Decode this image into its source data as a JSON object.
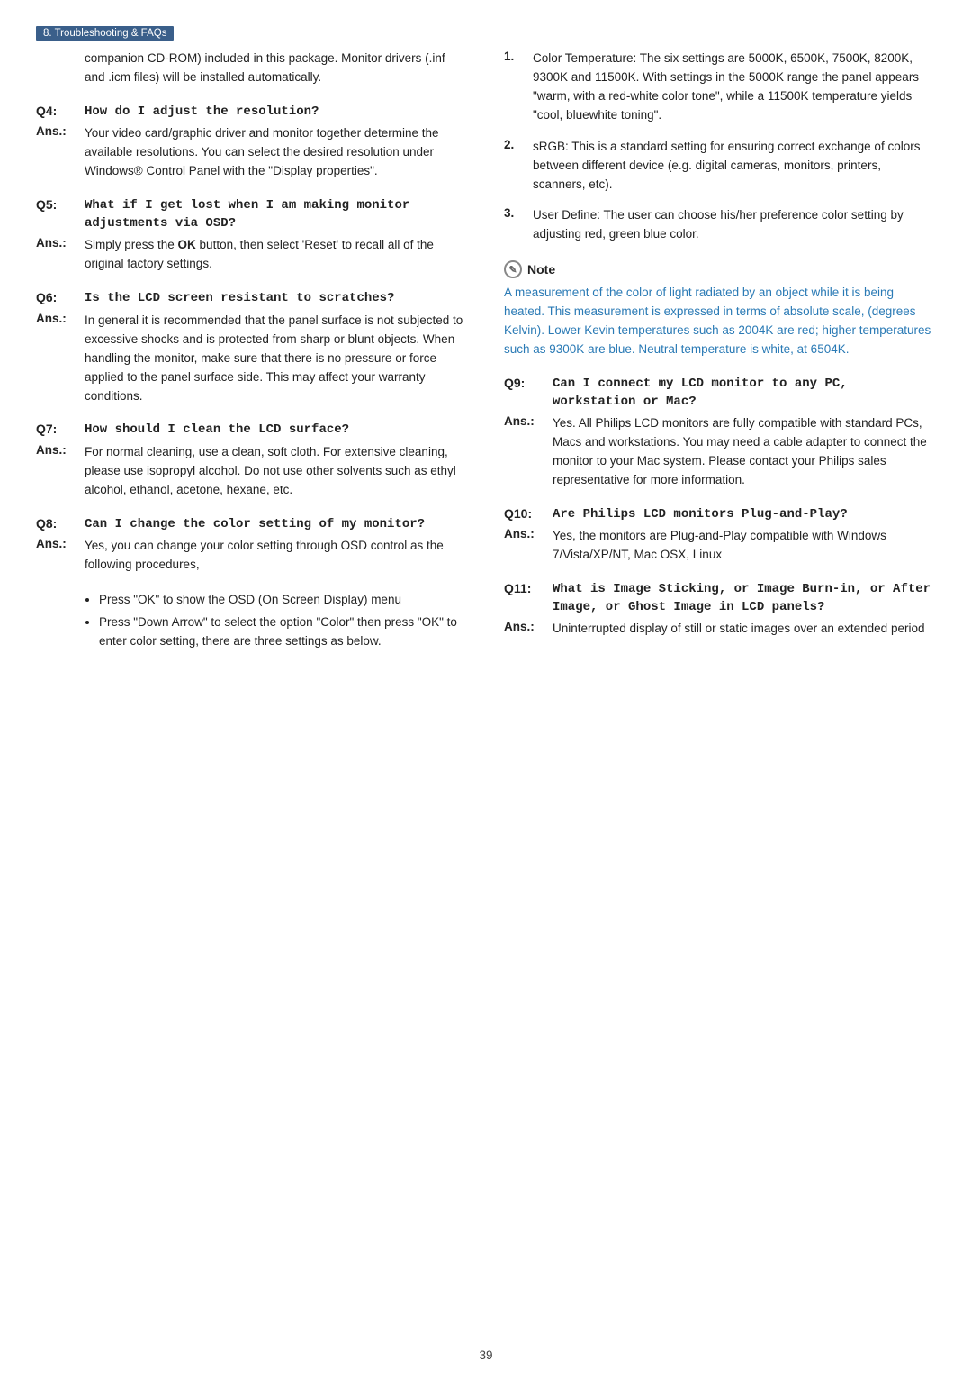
{
  "header": {
    "tag": "8. Troubleshooting & FAQs"
  },
  "intro": {
    "text": "companion CD-ROM) included in this package. Monitor drivers (.inf and .icm files) will be installed automatically."
  },
  "left_column": {
    "qa": [
      {
        "id": "q4",
        "q_label": "Q4:",
        "q_text": "How do I adjust the resolution?",
        "a_label": "Ans.:",
        "a_text": "Your video card/graphic driver and monitor together determine the available resolutions. You can select the desired resolution under Windows® Control Panel with the \"Display properties\"."
      },
      {
        "id": "q5",
        "q_label": "Q5:",
        "q_text": "What if I get lost when I am making monitor adjustments via OSD?",
        "a_label": "Ans.:",
        "a_text_pre": "Simply press the ",
        "a_bold": "OK",
        "a_text_post": " button, then select 'Reset' to recall all of the original factory settings."
      },
      {
        "id": "q6",
        "q_label": "Q6:",
        "q_text": "Is the LCD screen resistant to scratches?",
        "a_label": "Ans.:",
        "a_text": "In general it is recommended that the panel surface is not subjected to excessive shocks and is protected from sharp or blunt objects. When handling the monitor, make sure that there is no pressure or force applied to the panel surface side. This may affect your warranty conditions."
      },
      {
        "id": "q7",
        "q_label": "Q7:",
        "q_text": "How should I clean the LCD surface?",
        "a_label": "Ans.:",
        "a_text": "For normal cleaning, use a clean, soft cloth. For extensive cleaning, please use isopropyl alcohol. Do not use other solvents such as ethyl alcohol, ethanol, acetone, hexane, etc."
      },
      {
        "id": "q8",
        "q_label": "Q8:",
        "q_text": "Can I change the color setting of my monitor?",
        "a_label": "Ans.:",
        "a_text": "Yes, you can change your color setting through OSD control as the following procedures,"
      },
      {
        "id": "q8_bullets",
        "bullets": [
          "Press \"OK\" to show the OSD (On Screen Display) menu",
          "Press \"Down Arrow\" to select the option \"Color\" then press \"OK\" to enter color setting, there are three settings as below."
        ]
      }
    ]
  },
  "right_column": {
    "numbered_items": [
      {
        "num": "1.",
        "text": "Color Temperature: The six settings are 5000K, 6500K, 7500K, 8200K, 9300K and 11500K. With settings in the 5000K range the panel appears \"warm, with a red-white color tone\", while a 11500K temperature yields \"cool, bluewhite toning\"."
      },
      {
        "num": "2.",
        "text": "sRGB: This is a standard setting for ensuring correct exchange of colors between different device (e.g. digital cameras, monitors, printers, scanners, etc)."
      },
      {
        "num": "3.",
        "text": "User Define: The user can choose his/her preference color setting by adjusting red, green blue color."
      }
    ],
    "note": {
      "title": "Note",
      "text": "A measurement of the color of light radiated by an object while it is being heated. This measurement is expressed in terms of absolute scale, (degrees Kelvin). Lower Kevin temperatures such as 2004K are red; higher temperatures such as 9300K are blue. Neutral temperature is white, at 6504K."
    },
    "qa": [
      {
        "id": "q9",
        "q_label": "Q9:",
        "q_text": "Can I connect my LCD monitor to any PC, workstation or Mac?",
        "a_label": "Ans.:",
        "a_text": "Yes. All Philips LCD monitors are fully compatible with standard PCs, Macs and workstations. You may need a cable adapter to connect the monitor to your Mac system. Please contact your Philips sales representative for more information."
      },
      {
        "id": "q10",
        "q_label": "Q10:",
        "q_text": "Are Philips LCD monitors Plug-and-Play?",
        "a_label": "Ans.:",
        "a_text": "Yes, the monitors are Plug-and-Play compatible with Windows 7/Vista/XP/NT, Mac OSX, Linux"
      },
      {
        "id": "q11",
        "q_label": "Q11:",
        "q_text": "What is Image Sticking, or Image Burn-in, or After Image, or Ghost Image in LCD panels?",
        "a_label": "Ans.:",
        "a_text": "Uninterrupted display of still or static images over an extended period"
      }
    ]
  },
  "page_number": "39"
}
